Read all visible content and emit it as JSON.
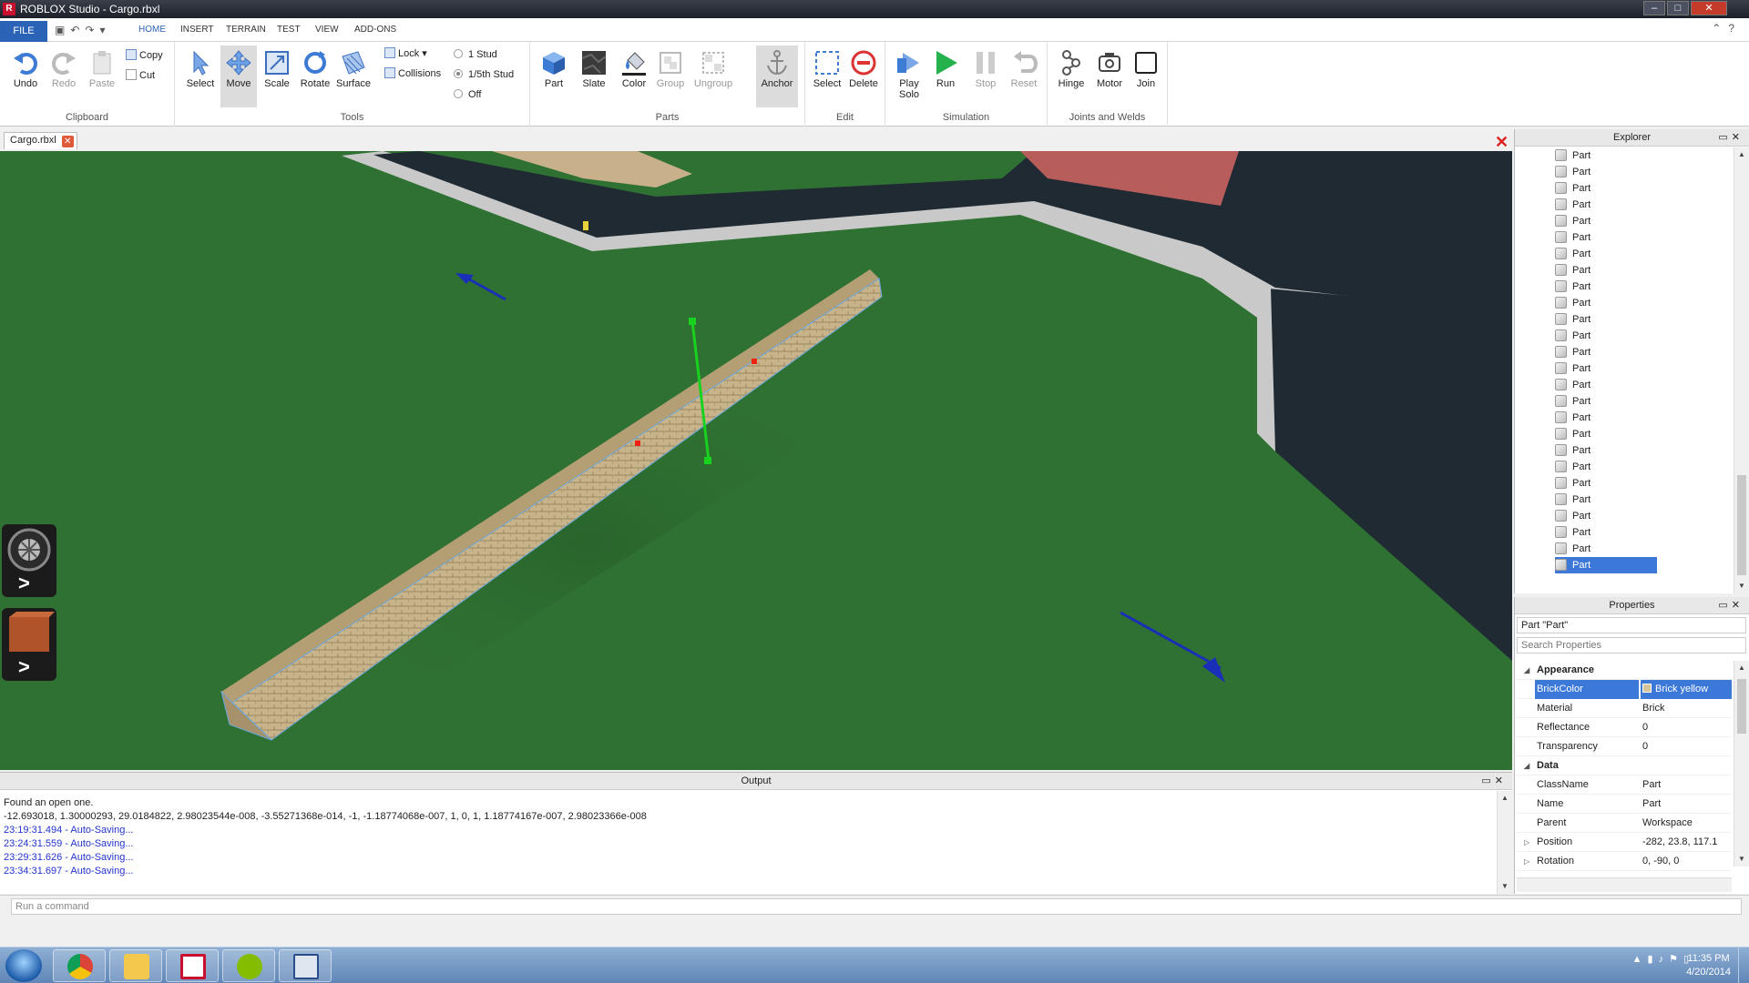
{
  "window": {
    "title": "ROBLOX Studio - Cargo.rbxl",
    "controls": [
      "–",
      "□",
      "✕"
    ]
  },
  "ribbon_tabs": {
    "file": "FILE",
    "tabs": [
      "HOME",
      "INSERT",
      "TERRAIN",
      "TEST",
      "VIEW",
      "ADD-ONS"
    ],
    "active": "HOME"
  },
  "clipboard": {
    "label": "Clipboard",
    "undo": "Undo",
    "redo": "Redo",
    "paste": "Paste",
    "copy": "Copy",
    "cut": "Cut"
  },
  "tools": {
    "label": "Tools",
    "select": "Select",
    "move": "Move",
    "scale": "Scale",
    "rotate": "Rotate",
    "surface": "Surface",
    "lock": "Lock",
    "collisions": "Collisions",
    "snap_options": [
      "1 Stud",
      "1/5th Stud",
      "Off"
    ],
    "snap_selected": "1/5th Stud"
  },
  "parts": {
    "label": "Parts",
    "part": "Part",
    "slate": "Slate",
    "color": "Color",
    "group": "Group",
    "ungroup": "Ungroup",
    "anchor": "Anchor"
  },
  "edit": {
    "label": "Edit",
    "select": "Select",
    "delete": "Delete"
  },
  "simulation": {
    "label": "Simulation",
    "play_solo_1": "Play",
    "play_solo_2": "Solo",
    "run": "Run",
    "stop": "Stop",
    "reset": "Reset"
  },
  "joints": {
    "label": "Joints and Welds",
    "hinge": "Hinge",
    "motor": "Motor",
    "join": "Join"
  },
  "document_tab": {
    "name": "Cargo.rbxl"
  },
  "explorer": {
    "title": "Explorer",
    "items": [
      "Part",
      "Part",
      "Part",
      "Part",
      "Part",
      "Part",
      "Part",
      "Part",
      "Part",
      "Part",
      "Part",
      "Part",
      "Part",
      "Part",
      "Part",
      "Part",
      "Part",
      "Part",
      "Part",
      "Part",
      "Part",
      "Part",
      "Part",
      "Part",
      "Part",
      "Part"
    ],
    "selected_index": 25
  },
  "properties": {
    "title": "Properties",
    "object": "Part \"Part\"",
    "search_placeholder": "Search Properties",
    "rows": [
      {
        "type": "category",
        "name": "Appearance"
      },
      {
        "type": "prop",
        "name": "BrickColor",
        "value": "Brick yellow",
        "selected": true
      },
      {
        "type": "prop",
        "name": "Material",
        "value": "Brick"
      },
      {
        "type": "prop",
        "name": "Reflectance",
        "value": "0"
      },
      {
        "type": "prop",
        "name": "Transparency",
        "value": "0"
      },
      {
        "type": "category",
        "name": "Data"
      },
      {
        "type": "prop",
        "name": "ClassName",
        "value": "Part"
      },
      {
        "type": "prop",
        "name": "Name",
        "value": "Part"
      },
      {
        "type": "prop",
        "name": "Parent",
        "value": "Workspace"
      },
      {
        "type": "prop",
        "name": "Position",
        "value": "-282, 23.8, 117.1",
        "expandable": true
      },
      {
        "type": "prop",
        "name": "Rotation",
        "value": "0, -90, 0",
        "expandable": true
      }
    ]
  },
  "output": {
    "title": "Output",
    "lines": [
      {
        "text": "Found an open one.",
        "color": "black"
      },
      {
        "text": "-12.693018, 1.30000293, 29.0184822, 2.98023544e-008, -3.55271368e-014, -1, -1.18774068e-007, 1, 0, 1, 1.18774167e-007, 2.98023366e-008",
        "color": "black"
      },
      {
        "text": "23:19:31.494 - Auto-Saving...",
        "color": "blue"
      },
      {
        "text": "23:24:31.559 - Auto-Saving...",
        "color": "blue"
      },
      {
        "text": "23:29:31.626 - Auto-Saving...",
        "color": "blue"
      },
      {
        "text": "23:34:31.697 - Auto-Saving...",
        "color": "blue"
      }
    ]
  },
  "command_bar": {
    "placeholder": "Run a command"
  },
  "taskbar": {
    "apps": [
      "chrome-icon",
      "folder-icon",
      "roblox-icon",
      "spotify-icon",
      "roblox-studio-icon"
    ],
    "time": "11:35 PM",
    "date": "4/20/2014"
  },
  "colors": {
    "accent": "#2b63b6",
    "selection": "#3c78d8",
    "grass": "#2f7132",
    "road": "#1f2a33",
    "sidewalk": "#c9c9c9",
    "brick_yellow": "#d7c59a",
    "move_handle_blue": "#1a2fb8",
    "move_handle_green": "#19d11f"
  }
}
